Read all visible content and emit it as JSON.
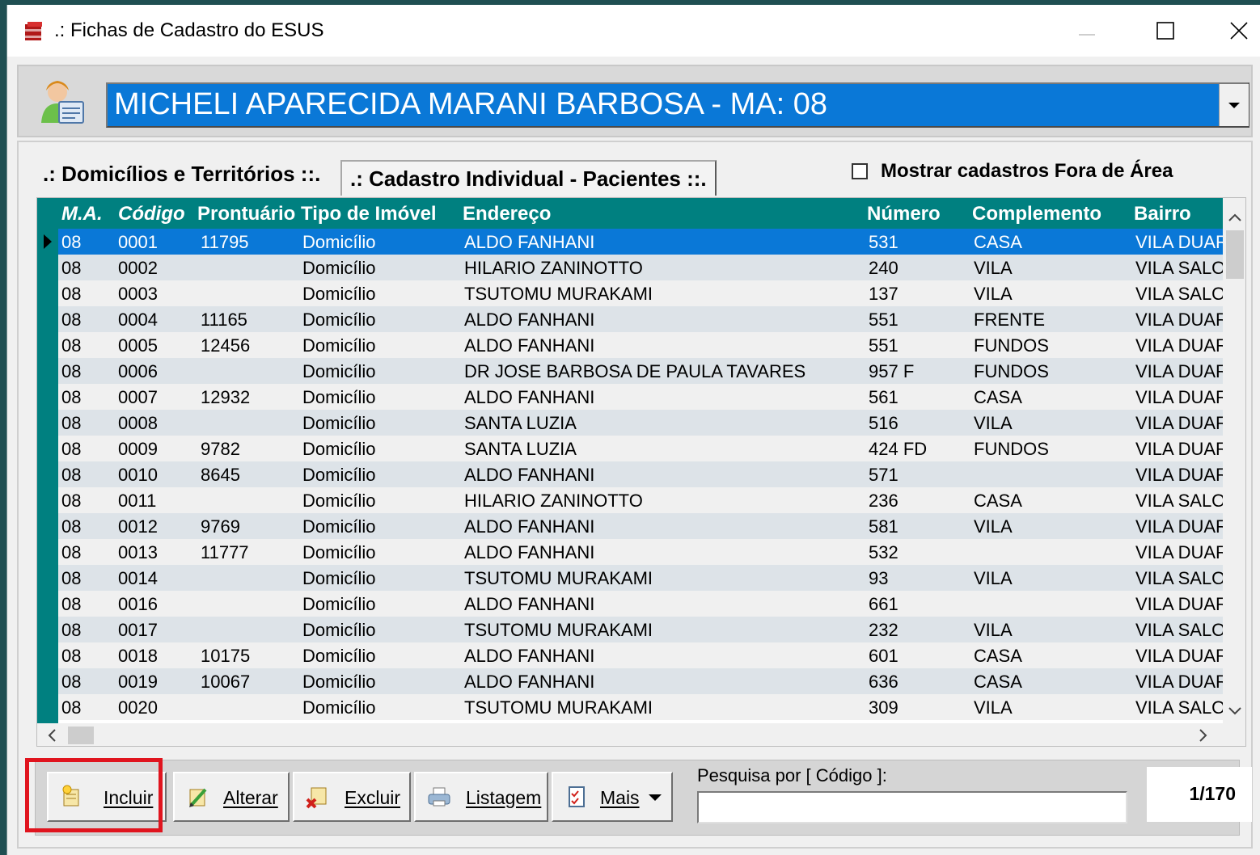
{
  "window": {
    "title": ".: Fichas de Cadastro do ESUS"
  },
  "agent": {
    "selected": "MICHELI APARECIDA MARANI BARBOSA - MA: 08"
  },
  "tabs": [
    {
      "label": ".: Domicílios e Territórios ::.",
      "active": true
    },
    {
      "label": ".: Cadastro Individual - Pacientes ::.",
      "active": false
    }
  ],
  "filter": {
    "fora_area_label": "Mostrar cadastros Fora de Área",
    "fora_area_checked": false
  },
  "table": {
    "columns": [
      "M.A.",
      "Código",
      "Prontuário",
      "Tipo de Imóvel",
      "Endereço",
      "Número",
      "Complemento",
      "Bairro"
    ],
    "rows": [
      [
        "08",
        "0001",
        "11795",
        "Domicílio",
        "ALDO FANHANI",
        "531",
        "CASA",
        "VILA DUAR"
      ],
      [
        "08",
        "0002",
        "",
        "Domicílio",
        "HILARIO ZANINOTTO",
        "240",
        "VILA",
        "VILA SALO"
      ],
      [
        "08",
        "0003",
        "",
        "Domicílio",
        "TSUTOMU MURAKAMI",
        "137",
        "VILA",
        "VILA SALO"
      ],
      [
        "08",
        "0004",
        "11165",
        "Domicílio",
        "ALDO FANHANI",
        "551",
        "FRENTE",
        "VILA DUAR"
      ],
      [
        "08",
        "0005",
        "12456",
        "Domicílio",
        "ALDO FANHANI",
        "551",
        "FUNDOS",
        "VILA DUAR"
      ],
      [
        "08",
        "0006",
        "",
        "Domicílio",
        "DR JOSE BARBOSA DE PAULA TAVARES",
        "957 F",
        "FUNDOS",
        "VILA DUAR"
      ],
      [
        "08",
        "0007",
        "12932",
        "Domicílio",
        "ALDO FANHANI",
        "561",
        "CASA",
        "VILA DUAR"
      ],
      [
        "08",
        "0008",
        "",
        "Domicílio",
        "SANTA LUZIA",
        "516",
        "VILA",
        "VILA DUAR"
      ],
      [
        "08",
        "0009",
        "9782",
        "Domicílio",
        "SANTA LUZIA",
        "424 FD",
        "FUNDOS",
        "VILA DUAR"
      ],
      [
        "08",
        "0010",
        "8645",
        "Domicílio",
        "ALDO FANHANI",
        "571",
        "",
        "VILA DUAR"
      ],
      [
        "08",
        "0011",
        "",
        "Domicílio",
        "HILARIO ZANINOTTO",
        "236",
        "CASA",
        "VILA SALO"
      ],
      [
        "08",
        "0012",
        "9769",
        "Domicílio",
        "ALDO FANHANI",
        "581",
        "VILA",
        "VILA DUAR"
      ],
      [
        "08",
        "0013",
        "11777",
        "Domicílio",
        "ALDO FANHANI",
        "532",
        "",
        "VILA DUAR"
      ],
      [
        "08",
        "0014",
        "",
        "Domicílio",
        "TSUTOMU MURAKAMI",
        "93",
        "VILA",
        "VILA SALO"
      ],
      [
        "08",
        "0016",
        "",
        "Domicílio",
        "ALDO FANHANI",
        "661",
        "",
        "VILA DUAR"
      ],
      [
        "08",
        "0017",
        "",
        "Domicílio",
        "TSUTOMU MURAKAMI",
        "232",
        "VILA",
        "VILA SALO"
      ],
      [
        "08",
        "0018",
        "10175",
        "Domicílio",
        "ALDO FANHANI",
        "601",
        "CASA",
        "VILA DUAR"
      ],
      [
        "08",
        "0019",
        "10067",
        "Domicílio",
        "ALDO FANHANI",
        "636",
        "CASA",
        "VILA DUAR"
      ],
      [
        "08",
        "0020",
        "",
        "Domicílio",
        "TSUTOMU MURAKAMI",
        "309",
        "VILA",
        "VILA SALO"
      ]
    ],
    "selected_row": 0
  },
  "toolbar": {
    "incluir": "Incluir",
    "alterar": "Alterar",
    "excluir": "Excluir",
    "listagem": "Listagem",
    "mais": "Mais"
  },
  "search": {
    "label": "Pesquisa por [ Código ]:",
    "value": ""
  },
  "counter": "1/170",
  "colors": {
    "grid_header": "#008080",
    "selection": "#0a78d7",
    "highlight": "#e0141e"
  }
}
